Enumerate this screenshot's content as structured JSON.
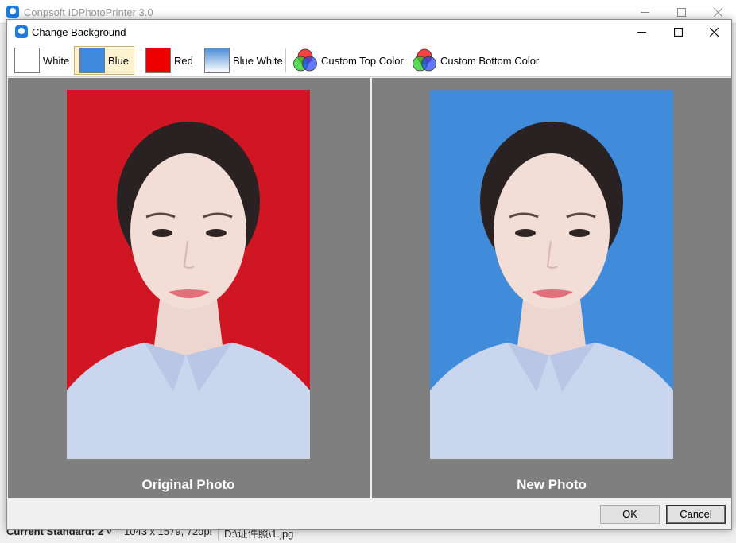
{
  "main_window": {
    "title": "Conpsoft IDPhotoPrinter 3.0",
    "status": {
      "standard": "Current Standard: 2 ˅",
      "size": "1043 x 1579, 72dpi",
      "path": "D:\\证件照\\1.jpg"
    }
  },
  "dialog": {
    "title": "Change Background",
    "toolbar": [
      {
        "label": "White",
        "color": "#ffffff",
        "selected": false
      },
      {
        "label": "Blue",
        "color": "#3f89dd",
        "selected": true
      },
      {
        "label": "Red",
        "color": "#ee0000",
        "selected": false
      },
      {
        "label": "Blue White",
        "gradient": [
          "#4a8fd6",
          "#ffffff"
        ],
        "selected": false
      },
      {
        "label": "Custom Top Color",
        "icon": "rgb-circles-icon"
      },
      {
        "label": "Custom Bottom Color",
        "icon": "rgb-circles-icon"
      }
    ],
    "original": {
      "caption": "Original Photo",
      "bg_color": "#d01622"
    },
    "new": {
      "caption": "New Photo",
      "bg_color": "#418bdb"
    },
    "ok_label": "OK",
    "cancel_label": "Cancel"
  }
}
